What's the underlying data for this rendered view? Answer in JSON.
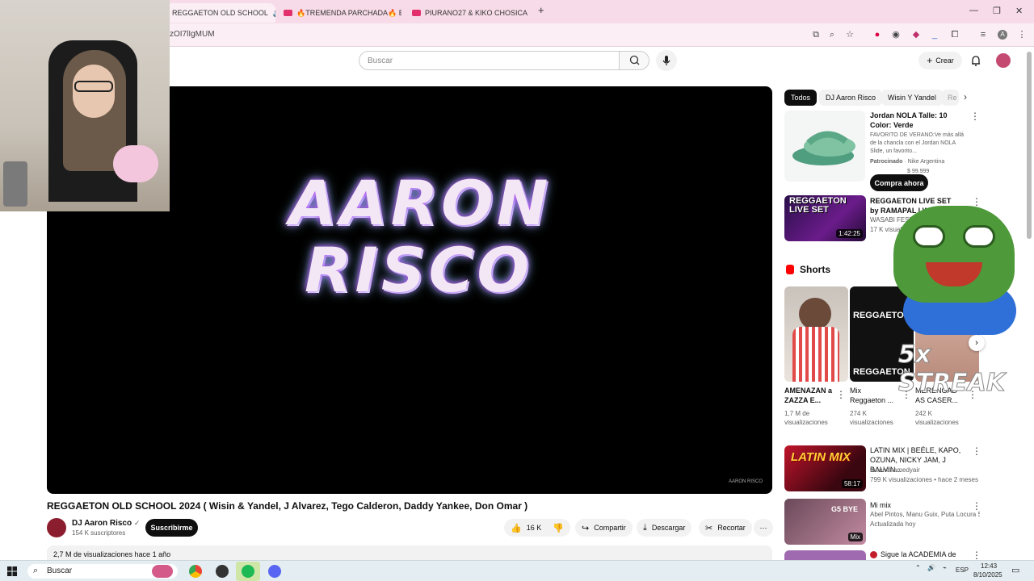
{
  "browser": {
    "tabs": [
      {
        "label": "REGGAETON OLD SCHOOL",
        "active": true
      },
      {
        "label": "🔥TREMENDA PARCHADA🔥 EL",
        "active": false
      },
      {
        "label": "PIURANO27 & KIKO CHOSICA",
        "active": false
      }
    ],
    "url": "zOI7lIgMUM",
    "window_controls": [
      "—",
      "❐",
      "✕"
    ]
  },
  "youtube": {
    "search_placeholder": "Buscar",
    "create_label": "Crear"
  },
  "video": {
    "logo_line1": "AARON",
    "logo_line2": "RISCO",
    "watermark": "AARON RISCO",
    "title": "REGGAETON OLD SCHOOL 2024 ( Wisin & Yandel, J Alvarez, Tego Calderon, Daddy Yankee, Don Omar )",
    "channel": "DJ Aaron Risco",
    "subscribers": "154 K suscriptores",
    "subscribe_label": "Suscribirme",
    "likes": "16 K",
    "share_label": "Compartir",
    "download_label": "Descargar",
    "clip_label": "Recortar",
    "views_date": "2,7 M de visualizaciones  hace 1 año"
  },
  "sidebar": {
    "chips": [
      "Todos",
      "DJ Aaron Risco",
      "Wisin Y Yandel",
      "Re"
    ],
    "ad": {
      "title": "Jordan NOLA Talle: 10 Color: Verde",
      "desc": "FAVORITO DE VERANO:Ve más allá de la chancla con el Jordan NOLA Slide, un favorito...",
      "sponsored": "Patrocinado",
      "advertiser": "· Nike Argentina",
      "price": "$ 99.999",
      "cta": "Compra ahora"
    },
    "rec1": {
      "thumb_text": "REGGAETON LIVE SET",
      "duration": "1:42:25",
      "title": "REGGAETON LIVE SET by RAMAPAL | WASABI",
      "channel": "WASABI FEST",
      "meta": "17 K visualizaciones"
    },
    "shorts_title": "Shorts",
    "shorts": [
      {
        "title": "AMENAZAN a ZAZZA E...",
        "views": "1,7 M de visualizaciones"
      },
      {
        "title": "Mix Reggaeton ...",
        "views": "274 K visualizaciones",
        "thumb_text": "REGGAETON"
      },
      {
        "title": "MERENGAD AS CASER...",
        "views": "242 K visualizaciones"
      }
    ],
    "rec2": {
      "thumb_text": "LATIN MIX",
      "duration": "58:17",
      "title": "LATIN MIX | BEÉLE, KAPO, OZUNA, NICKY JAM, J BALVIN...",
      "channel": "theonenamedyair",
      "meta": "799 K visualizaciones • hace 2 meses"
    },
    "rec3": {
      "thumb_text": "G5 BYE",
      "badge": "Mix",
      "title": "Mi mix",
      "channel": "Abel Pintos, Manu Guix, Puta Locura Star...",
      "meta": "Actualizada hoy"
    },
    "rec4": {
      "title": "Sigue la ACADEMIA de"
    }
  },
  "overlay": {
    "streak_text": "5x STREAK"
  },
  "taskbar": {
    "search_label": "Buscar",
    "lang": "ESP",
    "time": "12:43",
    "date": "8/10/2025"
  },
  "colors": {
    "accent": "#ff0000",
    "tabbar": "#f7dbe8",
    "dark": "#0f0f0f"
  }
}
